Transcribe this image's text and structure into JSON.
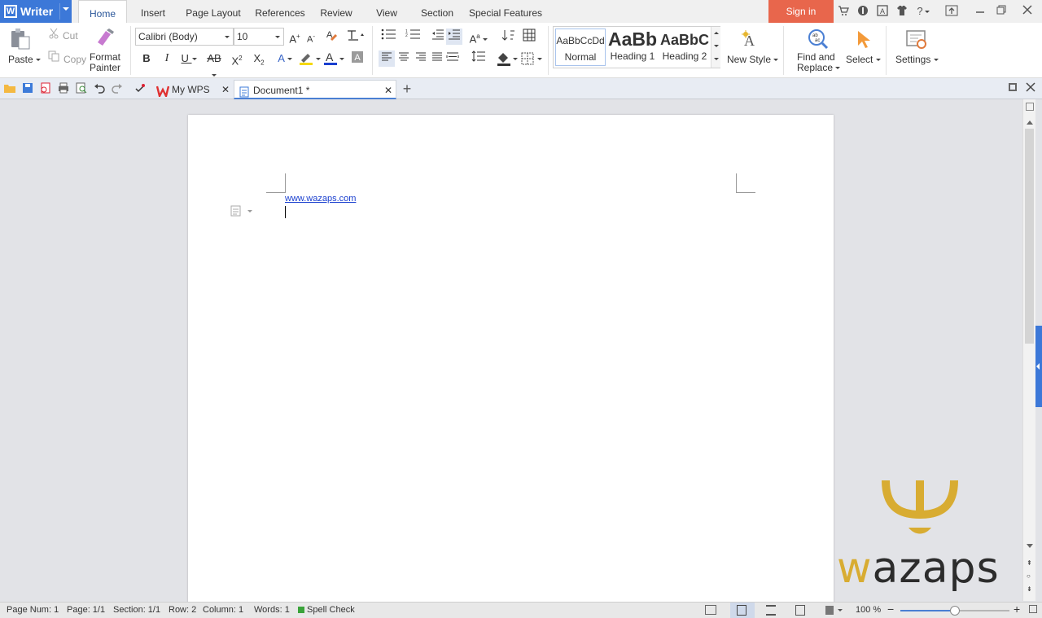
{
  "app": {
    "name": "Writer"
  },
  "menu_tabs": [
    "Home",
    "Insert",
    "Page Layout",
    "References",
    "Review",
    "View",
    "Section",
    "Special Features"
  ],
  "sign_in": "Sign in",
  "clipboard": {
    "paste": "Paste",
    "cut": "Cut",
    "copy": "Copy",
    "format_painter_1": "Format",
    "format_painter_2": "Painter"
  },
  "font": {
    "family": "Calibri (Body)",
    "size": "10"
  },
  "styles": [
    {
      "preview": "AaBbCcDd",
      "name": "Normal"
    },
    {
      "preview": "AaBb",
      "name": "Heading 1"
    },
    {
      "preview": "AaBbC",
      "name": "Heading 2"
    }
  ],
  "new_style": "New Style",
  "find_replace_1": "Find and",
  "find_replace_2": "Replace",
  "select": "Select",
  "settings": "Settings",
  "doc_tabs": {
    "my_wps": "My WPS",
    "document": "Document1 *"
  },
  "document": {
    "link_text": "www.wazaps.com"
  },
  "watermark": "wazaps",
  "status": {
    "page_num": "Page Num: 1",
    "page": "Page: 1/1",
    "section": "Section: 1/1",
    "row": "Row: 2",
    "column": "Column: 1",
    "words": "Words: 1",
    "spell_check": "Spell Check",
    "zoom": "100 %",
    "zoom_fraction": 0.5
  },
  "colors": {
    "accent": "#3c78d8",
    "signin": "#e8664c",
    "font_color": "#1a3fcf",
    "highlight": "#f5d800",
    "watermark_gold": "#d8ac32",
    "watermark_dark": "#2c2c2c",
    "spell_ok": "#3aa33a"
  }
}
